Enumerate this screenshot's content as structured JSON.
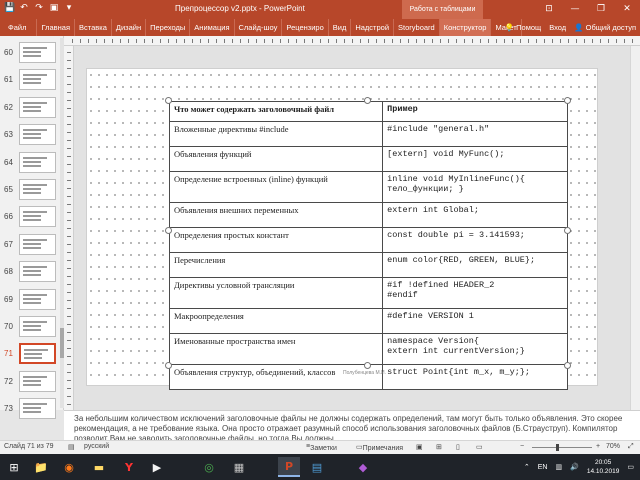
{
  "window": {
    "title": "Препроцессор v2.pptx - PowerPoint",
    "context_group": "Работа с таблицами",
    "controls": [
      "—",
      "❐",
      "✕"
    ]
  },
  "ribbon": {
    "tabs": [
      "Файл",
      "Главная",
      "Вставка",
      "Дизайн",
      "Переходы",
      "Анимация",
      "Слайд-шоу",
      "Рецензиро",
      "Вид",
      "Надстрой",
      "Storyboard",
      "Конструктор",
      "Макет"
    ],
    "active_tab": "Конструктор",
    "help": "Помощ",
    "signin": "Вход",
    "share": "Общий доступ"
  },
  "thumbnails": [
    {
      "num": "60"
    },
    {
      "num": "61"
    },
    {
      "num": "62"
    },
    {
      "num": "63"
    },
    {
      "num": "64"
    },
    {
      "num": "65"
    },
    {
      "num": "66"
    },
    {
      "num": "67"
    },
    {
      "num": "68"
    },
    {
      "num": "69"
    },
    {
      "num": "70"
    },
    {
      "num": "71",
      "selected": true
    },
    {
      "num": "72"
    },
    {
      "num": "73"
    }
  ],
  "slide": {
    "table": {
      "header": [
        "Что может содержать заголовочный файл",
        "Пример"
      ],
      "rows": [
        {
          "what": "Вложенные директивы #include",
          "example": [
            "#include \"general.h\""
          ]
        },
        {
          "what": "Объявления функций",
          "example": [
            "[extern] void MyFunc();"
          ]
        },
        {
          "what": "Определение встроенных (inline) функций",
          "example": [
            "inline void MyInlineFunc(){",
            "тело_функции; }"
          ]
        },
        {
          "what": "Объявления внешних переменных",
          "example": [
            "extern int Global;"
          ]
        },
        {
          "what": "Определения простых констант",
          "example": [
            "const double pi = 3.141593;"
          ]
        },
        {
          "what": "Перечисления",
          "example": [
            "enum color{RED, GREEN, BLUE};"
          ]
        },
        {
          "what": "Директивы условной трансляции",
          "example": [
            "#if !defined HEADER_2",
            "#endif"
          ]
        },
        {
          "what": "Макроопределения",
          "example": [
            "#define VERSION 1"
          ]
        },
        {
          "what": "Именованные пространства имен",
          "example": [
            "namespace Version{",
            "extern int currentVersion;}"
          ]
        },
        {
          "what": "Объявления структур, объединений, классов",
          "example": [
            "struct Point{int m_x, m_y;};"
          ]
        }
      ]
    },
    "footer": "Полубенцева М.И."
  },
  "notes": "За небольшим количеством исключений заголовочные файлы не должны содержать определений, там могут быть только объявления. Это скорее рекомендация, а не требование языка. Она просто отражает разумный способ использования заголовочных файлов (Б.Страуструп). Компилятор позволит Вам не заводить заголовочные файлы, но тогда Вы должны",
  "status": {
    "slide_counter": "Слайд 71 из 79",
    "language": "русский",
    "notes_btn": "Заметки",
    "comments_btn": "Примечания",
    "zoom": "70%"
  },
  "taskbar": {
    "lang": "EN",
    "time": "20:05",
    "date": "14.10.2019"
  },
  "colors": {
    "accent": "#b7472a",
    "selected_thumb": "#d24726",
    "taskbar": "#1f2329"
  }
}
